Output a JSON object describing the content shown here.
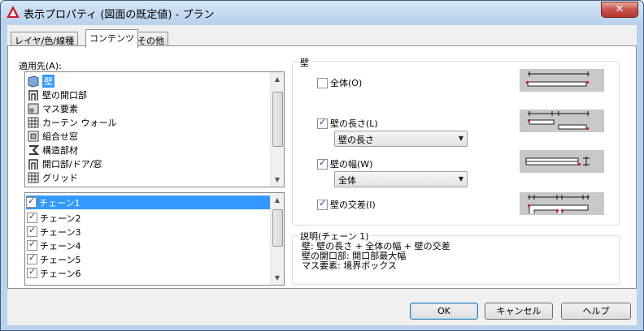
{
  "window": {
    "title": "表示プロパティ (図面の既定値) - プラン",
    "close_glyph": "✕"
  },
  "tabs": [
    {
      "label": "レイヤ/色/線種"
    },
    {
      "label": "コンテンツ"
    },
    {
      "label": "その他"
    }
  ],
  "apply_to": {
    "label": "適用先(A):",
    "objects": [
      {
        "label": "壁",
        "icon": "wall-icon",
        "selected": true
      },
      {
        "label": "壁の開口部",
        "icon": "wall-opening-icon"
      },
      {
        "label": "マス要素",
        "icon": "mass-element-icon"
      },
      {
        "label": "カーテン ウォール",
        "icon": "curtain-wall-icon"
      },
      {
        "label": "組合せ窓",
        "icon": "window-assembly-icon"
      },
      {
        "label": "構造部材",
        "icon": "structural-member-icon"
      },
      {
        "label": "開口部/ドア/窓",
        "icon": "opening-door-window-icon"
      },
      {
        "label": "グリッド",
        "icon": "grid-icon"
      }
    ],
    "chains": [
      {
        "label": "チェーン1",
        "checked": true,
        "selected": true
      },
      {
        "label": "チェーン2",
        "checked": true
      },
      {
        "label": "チェーン3",
        "checked": true
      },
      {
        "label": "チェーン4",
        "checked": true
      },
      {
        "label": "チェーン5",
        "checked": true
      },
      {
        "label": "チェーン6",
        "checked": true
      }
    ]
  },
  "wall_group": {
    "label": "壁",
    "overall": {
      "label": "全体(O)",
      "checked": false
    },
    "length": {
      "label": "壁の長さ(L)",
      "checked": true,
      "combo_value": "壁の長さ"
    },
    "width": {
      "label": "壁の幅(W)",
      "checked": true,
      "combo_value": "全体"
    },
    "intersection": {
      "label": "壁の交差(I)",
      "checked": true
    }
  },
  "description": {
    "label": "説明(チェーン 1)",
    "text": "壁: 壁の長さ + 全体の幅 + 壁の交差\n壁の開口部: 開口部最大幅\nマス要素: 境界ボックス"
  },
  "buttons": {
    "ok": "OK",
    "cancel": "キャンセル",
    "help": "ヘルプ"
  },
  "colors": {
    "selection": "#3399ff",
    "dimension_red": "#d62020",
    "preview_bg": "#c8c8c8"
  }
}
